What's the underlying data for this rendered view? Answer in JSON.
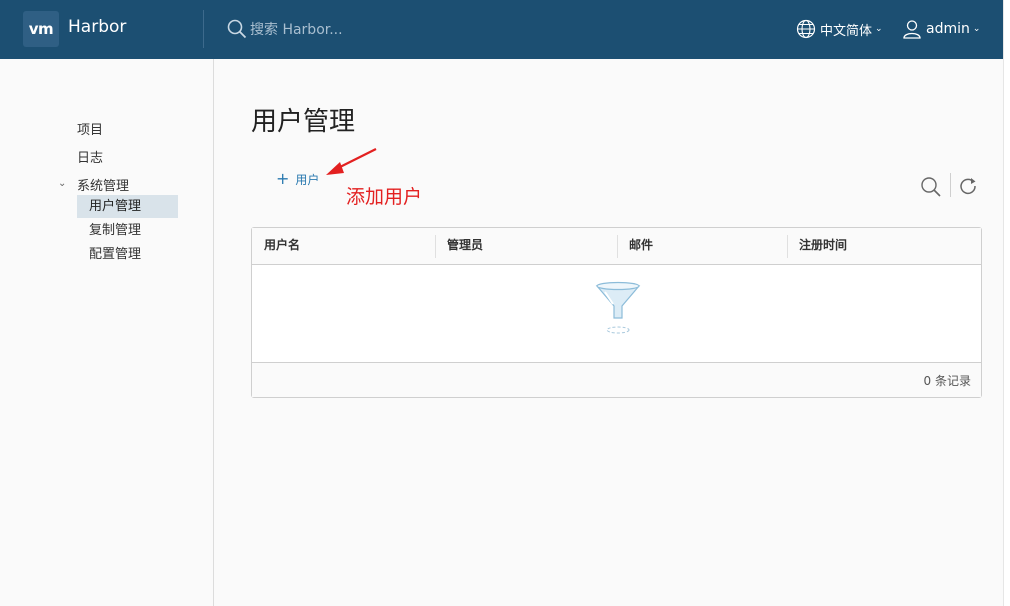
{
  "header": {
    "logo_text": "vm",
    "app_title": "Harbor",
    "search_placeholder": "搜索 Harbor...",
    "language": "中文简体",
    "username": "admin",
    "bg_color": "#1c4f72"
  },
  "sidebar": {
    "items": [
      {
        "label": "项目"
      },
      {
        "label": "日志"
      },
      {
        "label": "系统管理"
      }
    ],
    "sub_items": [
      {
        "label": "用户管理",
        "active": true
      },
      {
        "label": "复制管理",
        "active": false
      },
      {
        "label": "配置管理",
        "active": false
      }
    ]
  },
  "main": {
    "title": "用户管理",
    "add_user_label": "用户",
    "annotation": "添加用户",
    "annotation_color": "#e32020",
    "table": {
      "columns": [
        "用户名",
        "管理员",
        "邮件",
        "注册时间"
      ],
      "rows": [],
      "footer": "0 条记录"
    }
  },
  "icons": [
    "globe-icon",
    "user-icon",
    "search-icon",
    "refresh-icon",
    "filter-funnel-icon",
    "plus-icon",
    "chevron-down-icon"
  ]
}
